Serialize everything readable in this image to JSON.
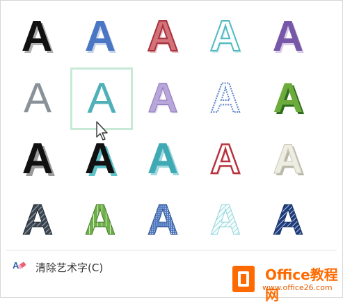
{
  "gallery": {
    "letter": "A",
    "styles": [
      {
        "name": "wordart-style-1"
      },
      {
        "name": "wordart-style-2"
      },
      {
        "name": "wordart-style-3"
      },
      {
        "name": "wordart-style-4"
      },
      {
        "name": "wordart-style-5"
      },
      {
        "name": "wordart-style-6"
      },
      {
        "name": "wordart-style-7"
      },
      {
        "name": "wordart-style-8"
      },
      {
        "name": "wordart-style-9"
      },
      {
        "name": "wordart-style-10"
      },
      {
        "name": "wordart-style-11"
      },
      {
        "name": "wordart-style-12"
      },
      {
        "name": "wordart-style-13"
      },
      {
        "name": "wordart-style-14"
      },
      {
        "name": "wordart-style-15"
      },
      {
        "name": "wordart-style-16"
      },
      {
        "name": "wordart-style-17"
      },
      {
        "name": "wordart-style-18"
      },
      {
        "name": "wordart-style-19"
      },
      {
        "name": "wordart-style-20"
      }
    ],
    "selected_index": 6
  },
  "clear": {
    "label": "清除艺术字(C)",
    "icon": "eraser-icon"
  },
  "watermark": {
    "title": "Office教程网",
    "url": "www.office26.com",
    "icon": "office-logo-icon"
  },
  "colors": {
    "selection_border": "#c6ead6",
    "accent_orange": "#ff6a00"
  }
}
